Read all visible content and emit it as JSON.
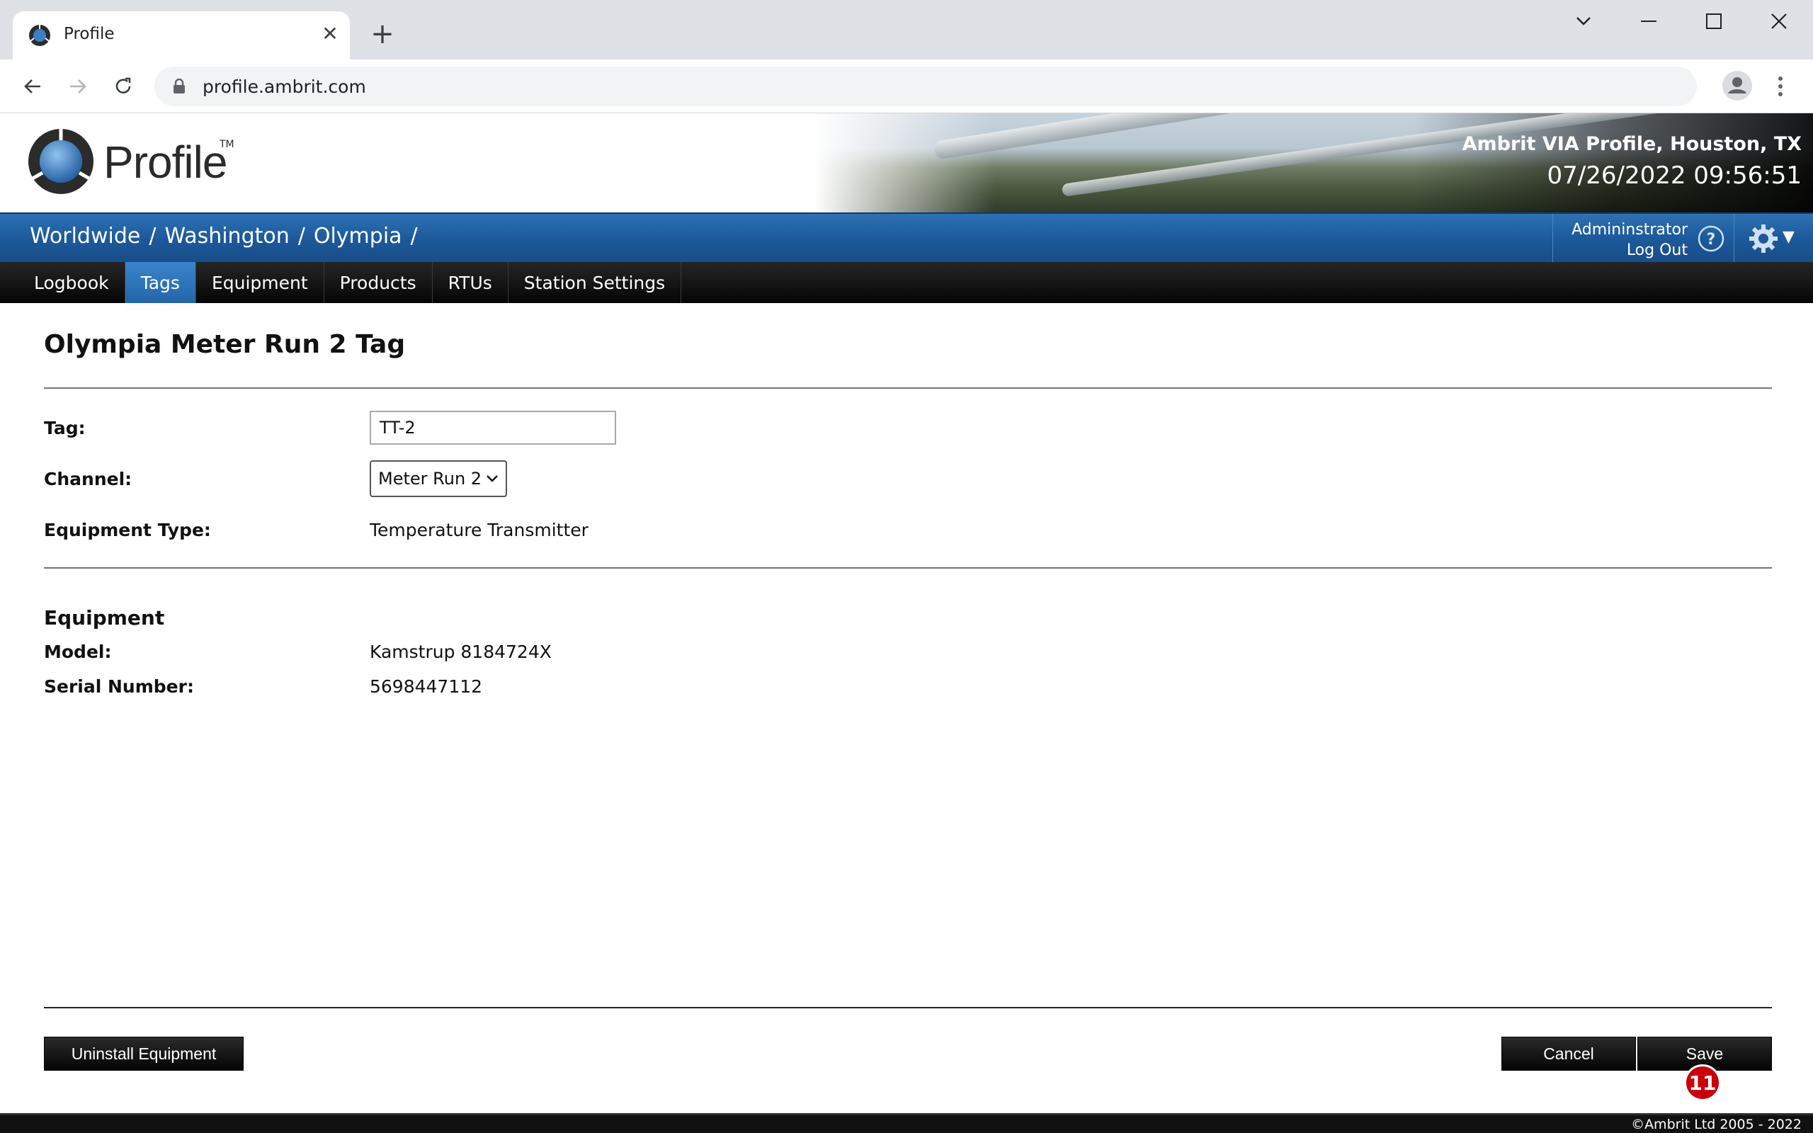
{
  "browser": {
    "tab_title": "Profile",
    "url": "profile.ambrit.com"
  },
  "header": {
    "logo_text": "Profile",
    "logo_tm": "TM",
    "site_name": "Ambrit VIA Profile, Houston, TX",
    "datetime": "07/26/2022 09:56:51"
  },
  "breadcrumb": {
    "items": [
      "Worldwide",
      "/",
      "Washington",
      "/",
      "Olympia",
      "/"
    ]
  },
  "user": {
    "name": "Admininstrator",
    "logout_label": "Log Out"
  },
  "nav": {
    "tabs": [
      "Logbook",
      "Tags",
      "Equipment",
      "Products",
      "RTUs",
      "Station Settings"
    ],
    "active": "Tags"
  },
  "main": {
    "title": "Olympia Meter Run 2 Tag",
    "tag_label": "Tag:",
    "tag_value": "TT-2",
    "channel_label": "Channel:",
    "channel_value": "Meter Run 2",
    "equipment_type_label": "Equipment Type:",
    "equipment_type_value": "Temperature Transmitter",
    "equipment_heading": "Equipment",
    "model_label": "Model:",
    "model_value": "Kamstrup 8184724X",
    "serial_label": "Serial Number:",
    "serial_value": "5698447112"
  },
  "actions": {
    "uninstall_label": "Uninstall Equipment",
    "cancel_label": "Cancel",
    "save_label": "Save",
    "badge_count": "11"
  },
  "footer": {
    "copyright": "©Ambrit Ltd 2005 - 2022"
  },
  "colors": {
    "accent_blue": "#1d5a9c",
    "active_tab": "#2565a8",
    "badge_red": "#c8000c"
  }
}
